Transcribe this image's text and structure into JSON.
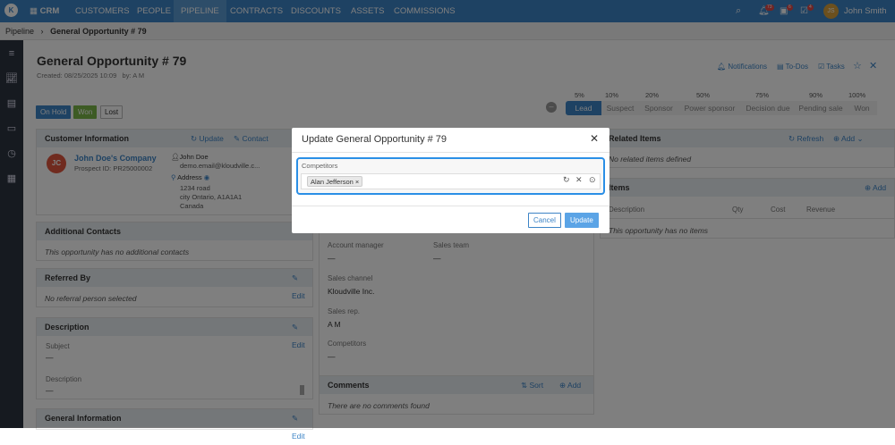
{
  "topnav": {
    "logo": "K",
    "crm": "CRM",
    "items": [
      "CUSTOMERS",
      "PEOPLE",
      "PIPELINE",
      "CONTRACTS",
      "DISCOUNTS",
      "ASSETS",
      "COMMISSIONS"
    ],
    "badges": {
      "notifications": "73",
      "calendar": "6",
      "tasks": "4"
    },
    "user": "John Smith",
    "user_initials": "JS"
  },
  "breadcrumb": {
    "root": "Pipeline",
    "current": "General Opportunity # 79"
  },
  "page": {
    "title": "General Opportunity # 79",
    "created_label": "Created:",
    "created_value": "08/25/2025 10:09",
    "by_label": "by:",
    "by_value": "A M",
    "actions": {
      "notifications": "Notifications",
      "todos": "To-Dos",
      "tasks": "Tasks"
    }
  },
  "status_buttons": {
    "on_hold": "On Hold",
    "won": "Won",
    "lost": "Lost"
  },
  "stages": [
    {
      "pct": "5%",
      "label": "Lead"
    },
    {
      "pct": "10%",
      "label": "Suspect"
    },
    {
      "pct": "20%",
      "label": "Sponsor"
    },
    {
      "pct": "50%",
      "label": "Power sponsor"
    },
    {
      "pct": "75%",
      "label": "Decision due"
    },
    {
      "pct": "90%",
      "label": "Pending sale"
    },
    {
      "pct": "100%",
      "label": "Won"
    }
  ],
  "customer": {
    "title": "Customer Information",
    "update": "Update",
    "contact": "Contact",
    "avatar": "JC",
    "company": "John Doe's Company",
    "prospect": "Prospect ID: PR25000002",
    "person": "John Doe",
    "email": "demo.email@kloudville.c...",
    "address_label": "Address",
    "address_line1": "1234 road",
    "address_line2": "city Ontario, A1A1A1",
    "address_line3": "Canada"
  },
  "additional_contacts": {
    "title": "Additional Contacts",
    "empty": "This opportunity has no additional contacts"
  },
  "referred_by": {
    "title": "Referred By",
    "edit": "Edit",
    "empty": "No referral person selected"
  },
  "description": {
    "title": "Description",
    "edit": "Edit",
    "subject_label": "Subject",
    "subject_value": "—",
    "description_label": "Description",
    "description_value": "—"
  },
  "general_info": {
    "title": "General Information",
    "edit": "Edit"
  },
  "middle": {
    "account_manager_label": "Account manager",
    "account_manager_value": "—",
    "sales_team_label": "Sales team",
    "sales_team_value": "—",
    "sales_channel_label": "Sales channel",
    "sales_channel_value": "Kloudville Inc.",
    "sales_rep_label": "Sales rep.",
    "sales_rep_value": "A M",
    "competitors_label": "Competitors",
    "competitors_value": "—"
  },
  "comments": {
    "title": "Comments",
    "sort": "Sort",
    "add": "Add",
    "empty": "There are no comments found"
  },
  "related_items": {
    "title": "Related Items",
    "refresh": "Refresh",
    "add": "Add",
    "empty": "No related items defined"
  },
  "items": {
    "title": "Items",
    "add": "Add",
    "columns": [
      "Description",
      "Qty",
      "Cost",
      "Revenue"
    ],
    "empty": "This opportunity has no items"
  },
  "modal": {
    "title": "Update General Opportunity # 79",
    "field_label": "Competitors",
    "tag": "Alan Jefferson",
    "cancel": "Cancel",
    "update": "Update"
  },
  "colors": {
    "primary": "#3d84c6",
    "on_hold": "#3d84c6",
    "won": "#7ab648",
    "header_bg": "#e9eef2"
  }
}
